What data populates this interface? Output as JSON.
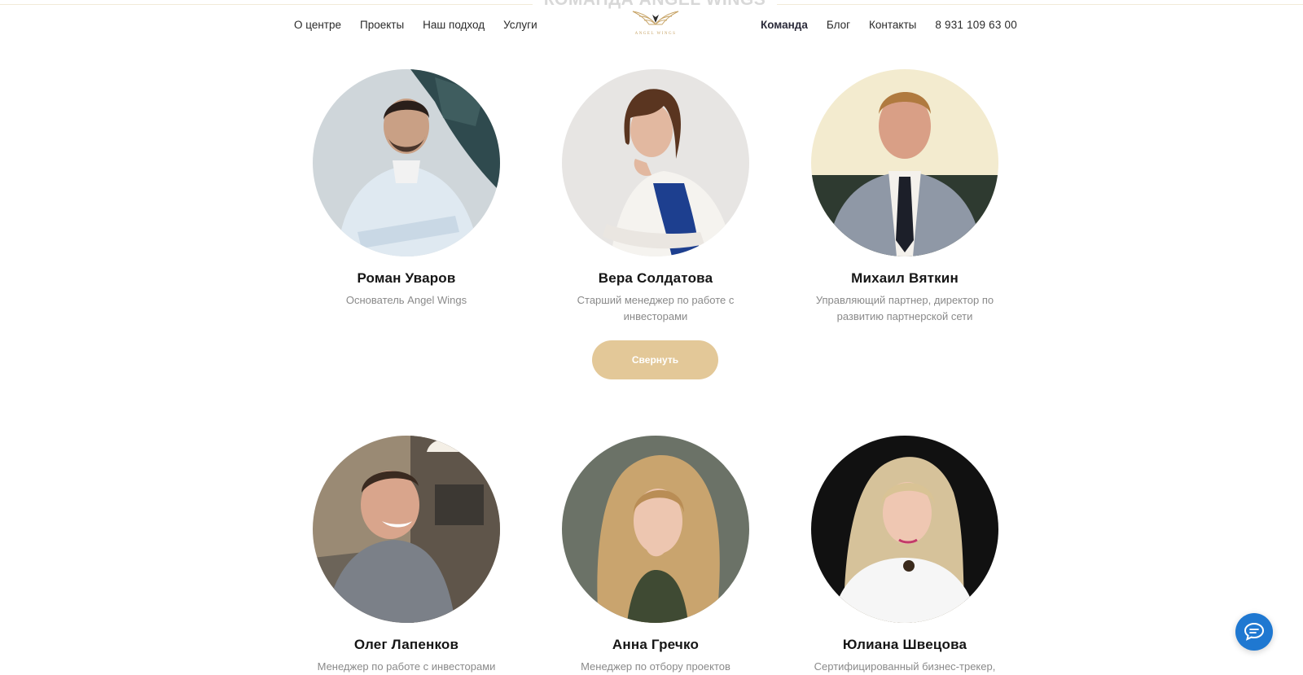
{
  "header": {
    "section_title": "КОМАНДА ANGEL WINGS",
    "nav_left": [
      "О центре",
      "Проекты",
      "Наш подход",
      "Услуги"
    ],
    "nav_right": [
      "Команда",
      "Блог",
      "Контакты"
    ],
    "phone": "8 931 109 63 00",
    "active_item": "Команда",
    "logo_text": "ANGEL WINGS"
  },
  "team": [
    {
      "name": "Роман Уваров",
      "role": "Основатель Angel Wings"
    },
    {
      "name": "Вера Солдатова",
      "role": "Старший менеджер по работе с инвесторами"
    },
    {
      "name": "Михаил Вяткин",
      "role": "Управляющий партнер, директор по развитию партнерской сети"
    },
    {
      "name": "Олег Лапенков",
      "role": "Менеджер по работе с инвесторами"
    },
    {
      "name": "Анна Гречко",
      "role": "Менеджер по отбору проектов"
    },
    {
      "name": "Юлиана Швецова",
      "role": "Сертифицированный бизнес-трекер,"
    }
  ],
  "collapse_button": "Свернуть",
  "colors": {
    "accent": "#e3c898",
    "logo_gold": "#c7a467",
    "chat_blue": "#1f78d1"
  },
  "icons": {
    "chat": "chat-bubble-icon",
    "logo": "angel-wings-logo"
  }
}
